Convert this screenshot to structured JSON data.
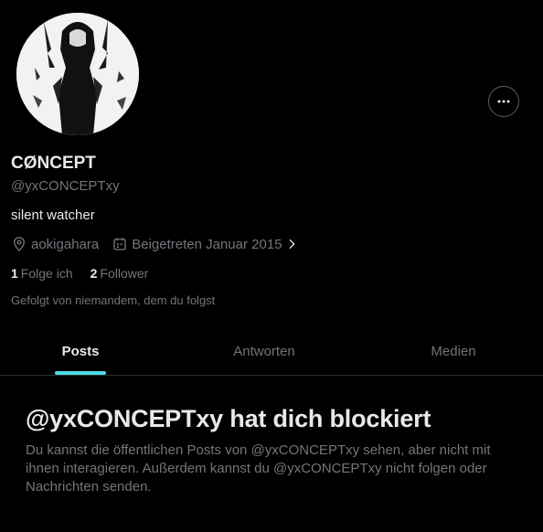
{
  "profile": {
    "display_name": "CØNCEPT",
    "handle": "@yxCONCEPTxy",
    "bio": "silent watcher",
    "location": "aokigahara",
    "joined": "Beigetreten Januar 2015",
    "following_count": "1",
    "following_label": "Folge ich",
    "followers_count": "2",
    "followers_label": "Follower",
    "followed_by": "Gefolgt von niemandem, dem du folgst"
  },
  "icons": {
    "more": "more-icon",
    "location": "location-pin-icon",
    "calendar": "calendar-icon",
    "chevron": "chevron-right-icon"
  },
  "tabs": [
    {
      "label": "Posts",
      "active": true
    },
    {
      "label": "Antworten",
      "active": false
    },
    {
      "label": "Medien",
      "active": false
    }
  ],
  "blocked": {
    "title": "@yxCONCEPTxy hat dich blockiert",
    "text": "Du kannst die öffentlichen Posts von @yxCONCEPTxy sehen, aber nicht mit ihnen interagieren. Außerdem kannst du @yxCONCEPTxy nicht folgen oder Nachrichten senden."
  },
  "colors": {
    "accent": "#4ddbe8",
    "background": "#000000",
    "primary_text": "#e7e9ea",
    "secondary_text": "#71767b"
  }
}
